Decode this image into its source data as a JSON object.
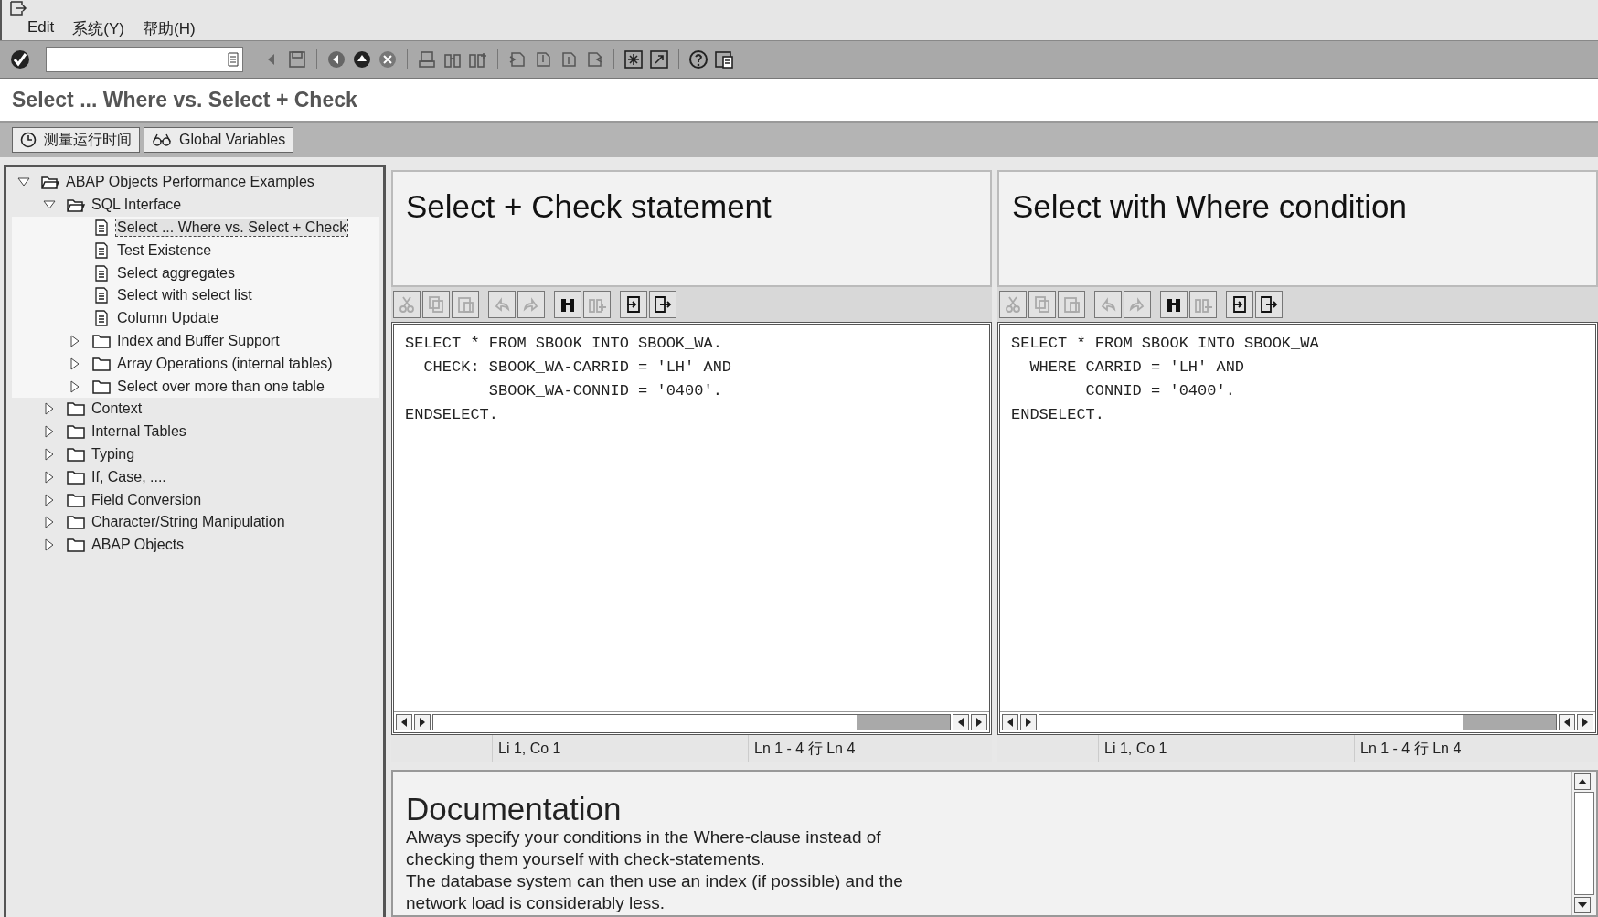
{
  "menu": [
    "Edit",
    "系统(Y)",
    "帮助(H)"
  ],
  "title": "Select ... Where vs. Select + Check",
  "app_buttons": [
    {
      "kind": "clock",
      "label": "测量运行时间"
    },
    {
      "kind": "glasses",
      "label": "Global Variables"
    }
  ],
  "tree": [
    {
      "label": "ABAP Objects Performance Examples",
      "kind": "folder",
      "expanded": true,
      "selected": false,
      "children": [
        {
          "label": "SQL Interface",
          "kind": "folder",
          "expanded": true,
          "selected": false,
          "children": [
            {
              "label": "Select ... Where vs. Select + Check",
              "kind": "document",
              "selected": true
            },
            {
              "label": "Test Existence",
              "kind": "document",
              "selected": false
            },
            {
              "label": "Select aggregates",
              "kind": "document",
              "selected": false
            },
            {
              "label": "Select with select list",
              "kind": "document",
              "selected": false
            },
            {
              "label": "Column Update",
              "kind": "document",
              "selected": false
            },
            {
              "label": "Index and Buffer Support",
              "kind": "folder",
              "expanded": false,
              "selected": false
            },
            {
              "label": "Array Operations (internal tables)",
              "kind": "folder",
              "expanded": false,
              "selected": false
            },
            {
              "label": "Select over more than one table",
              "kind": "folder",
              "expanded": false,
              "selected": false
            }
          ]
        },
        {
          "label": "Context",
          "kind": "folder",
          "expanded": false,
          "selected": false
        },
        {
          "label": "Internal Tables",
          "kind": "folder",
          "expanded": false,
          "selected": false
        },
        {
          "label": "Typing",
          "kind": "folder",
          "expanded": false,
          "selected": false
        },
        {
          "label": "If, Case, ....",
          "kind": "folder",
          "expanded": false,
          "selected": false
        },
        {
          "label": "Field Conversion",
          "kind": "folder",
          "expanded": false,
          "selected": false
        },
        {
          "label": "Character/String Manipulation",
          "kind": "folder",
          "expanded": false,
          "selected": false
        },
        {
          "label": "ABAP Objects",
          "kind": "folder",
          "expanded": false,
          "selected": false
        }
      ]
    }
  ],
  "editors": [
    {
      "heading": "Select + Check statement",
      "code": [
        "SELECT * FROM SBOOK INTO SBOOK_WA.",
        "  CHECK: SBOOK_WA-CARRID = 'LH' AND",
        "         SBOOK_WA-CONNID = '0400'.",
        "ENDSELECT."
      ],
      "status": [
        "Li 1, Co 1",
        "Ln 1 - 4 行 Ln 4"
      ]
    },
    {
      "heading": "Select with Where condition",
      "code": [
        "SELECT * FROM SBOOK INTO SBOOK_WA",
        "  WHERE CARRID = 'LH' AND",
        "        CONNID = '0400'.",
        "ENDSELECT."
      ],
      "status": [
        "Li 1, Co 1",
        "Ln 1 - 4 行 Ln 4"
      ]
    }
  ],
  "editor_tools": [
    {
      "kind": "cut",
      "disabled": true
    },
    {
      "kind": "copy",
      "disabled": true
    },
    {
      "kind": "paste",
      "disabled": true
    },
    {
      "kind": "undo",
      "disabled": true
    },
    {
      "kind": "redo",
      "disabled": true
    },
    {
      "kind": "find",
      "disabled": false
    },
    {
      "kind": "find-next",
      "disabled": true
    },
    {
      "kind": "import",
      "disabled": false
    },
    {
      "kind": "export",
      "disabled": false
    }
  ],
  "documentation": {
    "heading": "Documentation",
    "text": "Always specify your conditions in the Where-clause instead of\nchecking them yourself with check-statements.\nThe database system can then use an index (if possible) and the\nnetwork load is considerably less."
  }
}
